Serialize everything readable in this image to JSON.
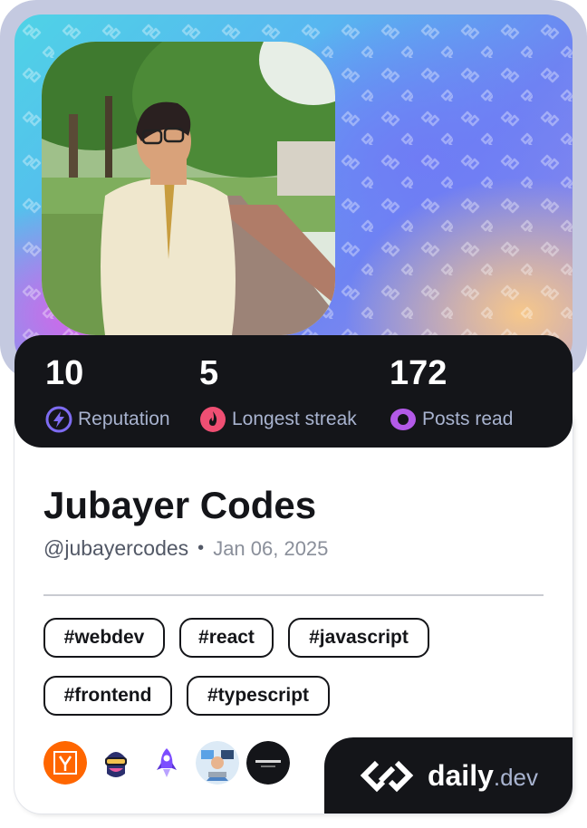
{
  "stats": {
    "reputation": {
      "value": "10",
      "label": "Reputation",
      "icon": "lightning-icon",
      "color": "#7e6cf2"
    },
    "streak": {
      "value": "5",
      "label": "Longest streak",
      "icon": "flame-icon",
      "color": "#ef4f73"
    },
    "posts": {
      "value": "172",
      "label": "Posts read",
      "icon": "eye-icon",
      "color": "#b35ae8"
    }
  },
  "profile": {
    "name": "Jubayer Codes",
    "handle": "@jubayercodes",
    "separator": "•",
    "joined": "Jan 06, 2025"
  },
  "tags": [
    "#webdev",
    "#react",
    "#javascript",
    "#frontend",
    "#typescript"
  ],
  "sources": [
    {
      "name": "hacker-news",
      "icon": "y-combinator-icon",
      "color": "#ff6600"
    },
    {
      "name": "vr-dev",
      "icon": "vr-headset-icon",
      "color": "#1f2a44"
    },
    {
      "name": "rocket",
      "icon": "rocket-icon",
      "color": "#7c4dff"
    },
    {
      "name": "developer",
      "icon": "developer-avatar-icon",
      "color": "#5aa2e6"
    },
    {
      "name": "dark-source",
      "icon": "dark-logo-icon",
      "color": "#141519"
    }
  ],
  "brand": {
    "name": "daily",
    "suffix": ".dev",
    "icon": "daily-dev-logo-icon"
  },
  "colors": {
    "dark": "#141519",
    "muted": "#a8b3cf",
    "frame": "#c4c9e0"
  }
}
